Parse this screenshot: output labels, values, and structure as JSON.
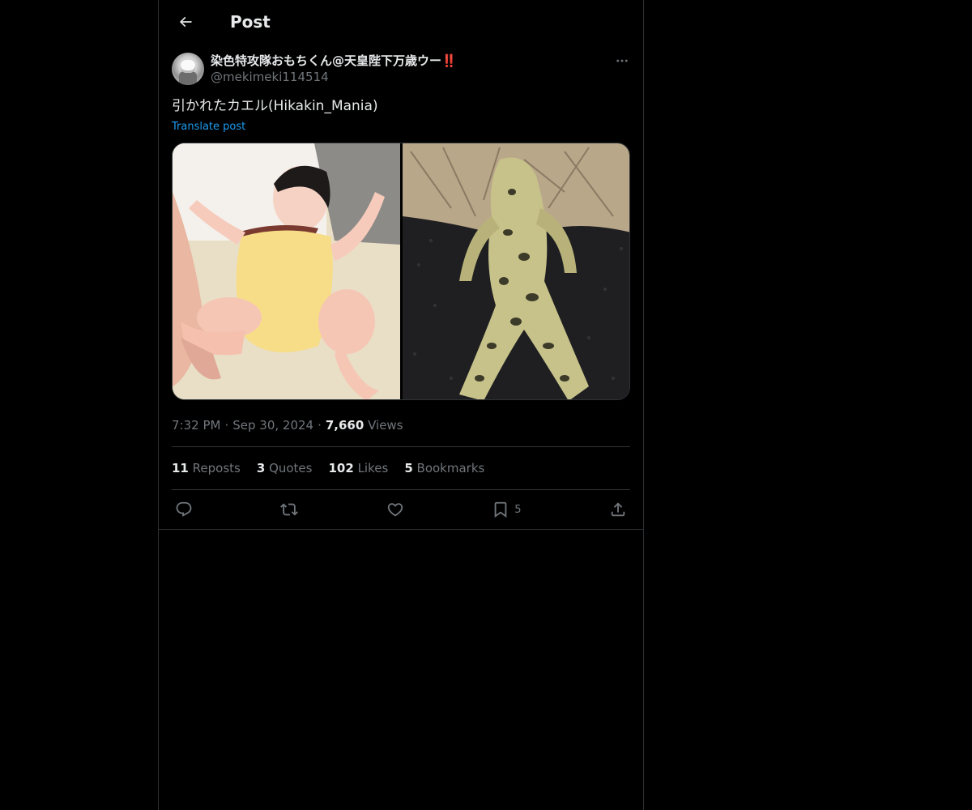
{
  "header": {
    "title": "Post"
  },
  "author": {
    "display_name": "染色特攻隊おもちくん@天皇陛下万歳ウー",
    "display_name_emoji": "‼️",
    "handle": "@mekimeki114514"
  },
  "post": {
    "text": "引かれたカエル(Hikakin_Mania)",
    "translate_label": "Translate post",
    "media": [
      {
        "description_icon": "baby-photo"
      },
      {
        "description_icon": "frog-photo"
      }
    ]
  },
  "meta": {
    "time": "7:32 PM",
    "date": "Sep 30, 2024",
    "views_count": "7,660",
    "views_label": "Views"
  },
  "stats": {
    "reposts_count": "11",
    "reposts_label": "Reposts",
    "quotes_count": "3",
    "quotes_label": "Quotes",
    "likes_count": "102",
    "likes_label": "Likes",
    "bookmarks_count": "5",
    "bookmarks_label": "Bookmarks"
  },
  "actions": {
    "bookmark_count": "5"
  },
  "colors": {
    "background": "#000000",
    "text": "#e7e9ea",
    "muted": "#71767b",
    "link": "#1d9bf0",
    "border": "#2f3336"
  }
}
